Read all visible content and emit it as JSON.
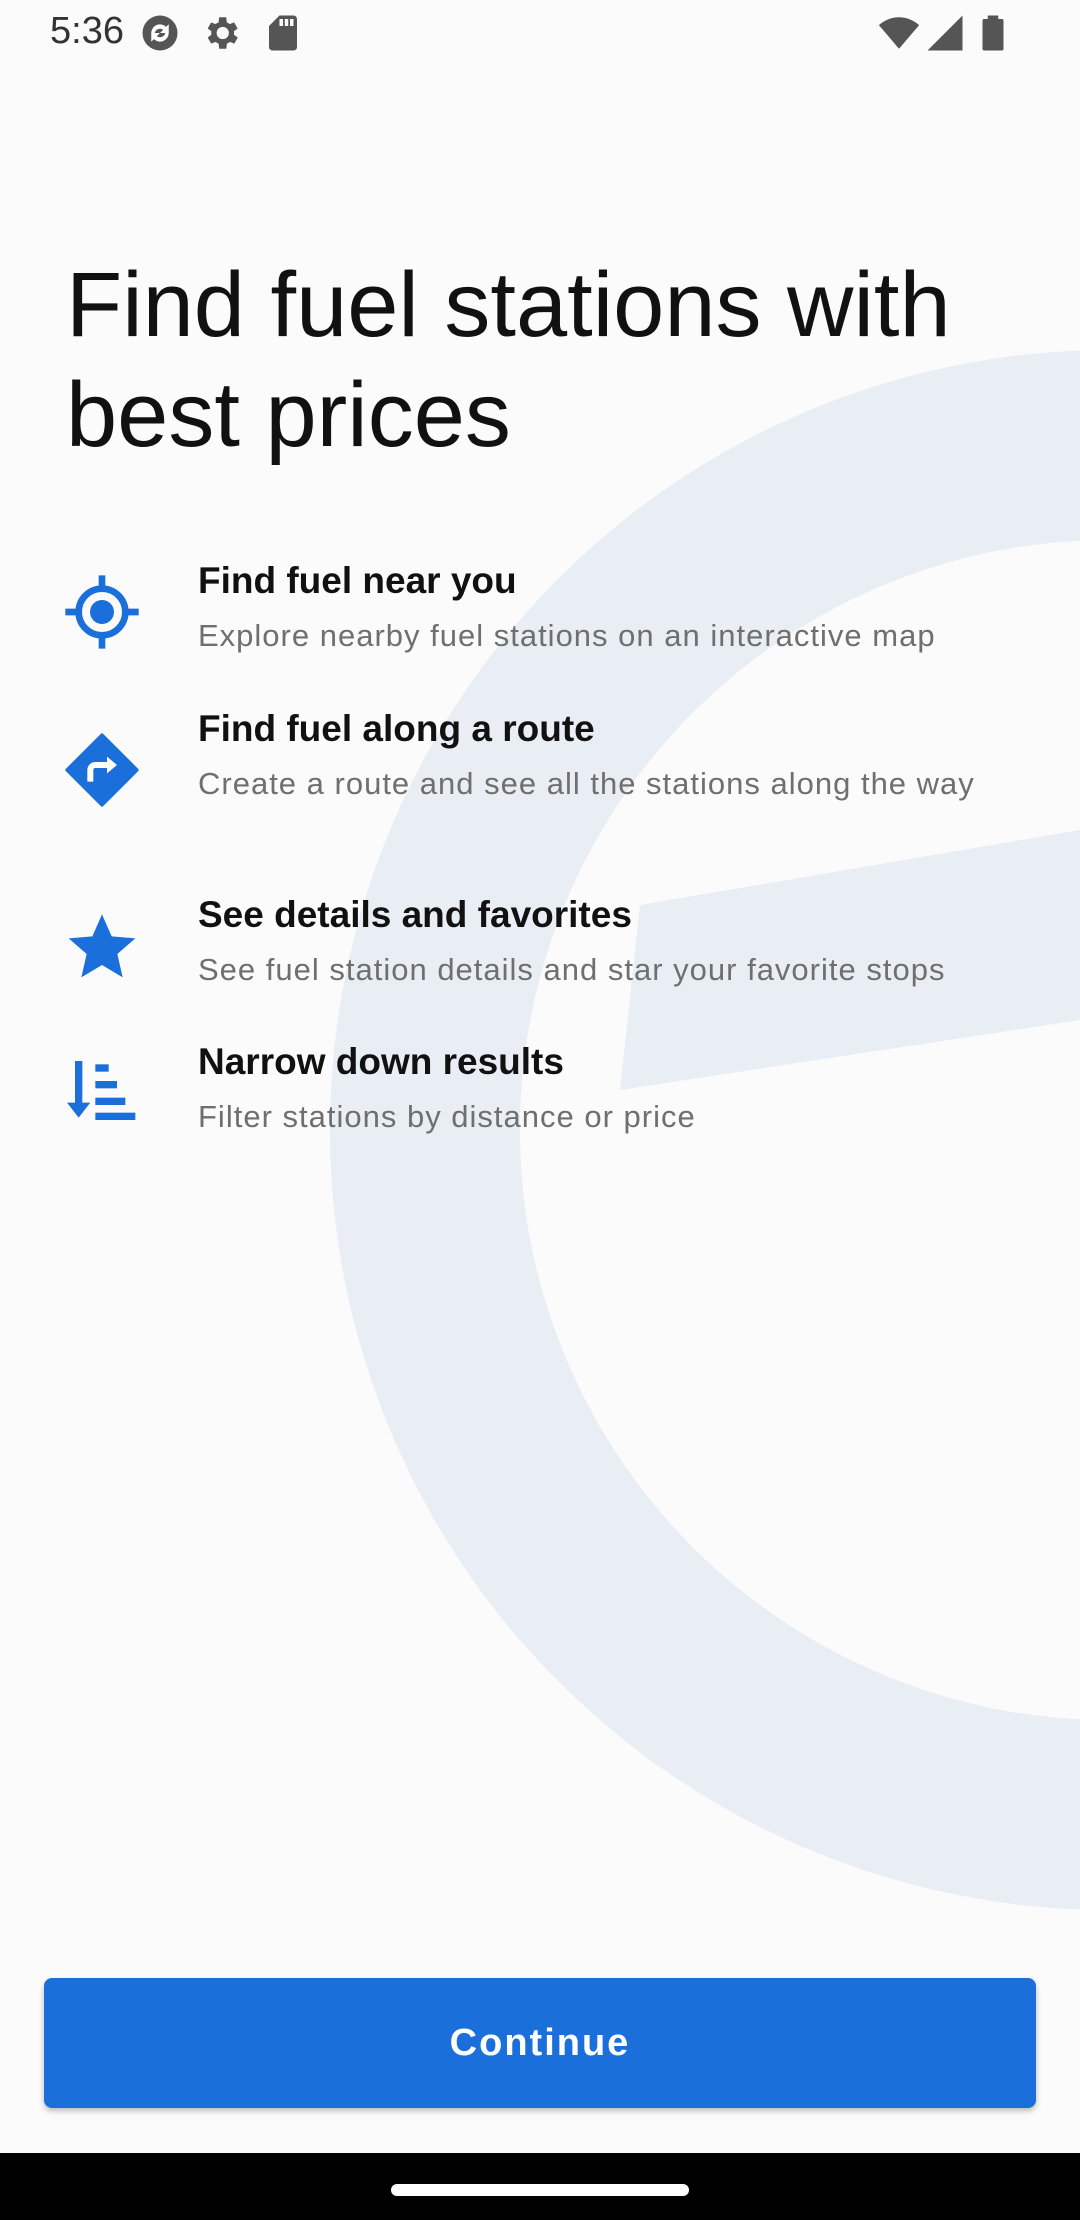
{
  "status_bar": {
    "time": "5:36",
    "left_icons": [
      "sync-icon",
      "gear-icon",
      "sd-card-icon"
    ],
    "right_icons": [
      "wifi-icon",
      "signal-icon",
      "battery-icon"
    ]
  },
  "headline": "Find fuel stations with best prices",
  "features": [
    {
      "icon": "location-target-icon",
      "title": "Find fuel near you",
      "description": "Explore nearby fuel stations on an interactive map"
    },
    {
      "icon": "route-diamond-icon",
      "title": "Find fuel along a route",
      "description": "Create a route and see all the stations along the way"
    },
    {
      "icon": "star-icon",
      "title": "See details and favorites",
      "description": "See fuel station details and star your favorite stops"
    },
    {
      "icon": "sort-filter-icon",
      "title": "Narrow down results",
      "description": "Filter stations by distance or price"
    }
  ],
  "continue_label": "Continue",
  "colors": {
    "accent": "#1a6fdb",
    "background_art": "#e9eef5",
    "title_text": "#111111",
    "description_text": "#6f6f6f"
  }
}
